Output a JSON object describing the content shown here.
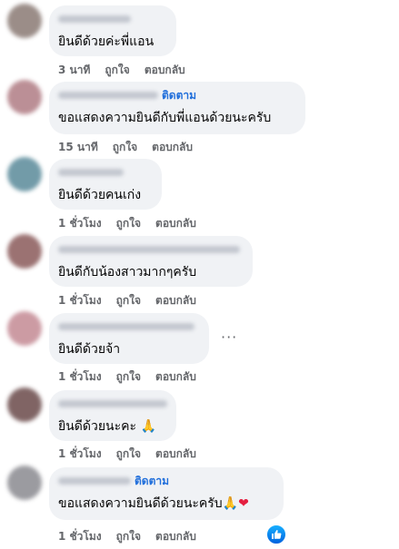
{
  "comments": [
    {
      "text": "ยินดีด้วยค่ะพี่แอน",
      "time": "3 นาที",
      "like": "ถูกใจ",
      "reply": "ตอบกลับ",
      "follow": ""
    },
    {
      "text": "ขอแสดงความยินดีกับพี่แอนด้วยนะครับ",
      "time": "15 นาที",
      "like": "ถูกใจ",
      "reply": "ตอบกลับ",
      "follow": "ติดตาม"
    },
    {
      "text": "ยินดีด้วยคนเก่ง",
      "time": "1 ชั่วโมง",
      "like": "ถูกใจ",
      "reply": "ตอบกลับ",
      "follow": ""
    },
    {
      "text": "ยินดีกับน้องสาวมากๆครับ",
      "time": "1 ชั่วโมง",
      "like": "ถูกใจ",
      "reply": "ตอบกลับ",
      "follow": ""
    },
    {
      "text": "ยินดีด้วยจ้า",
      "time": "1 ชั่วโมง",
      "like": "ถูกใจ",
      "reply": "ตอบกลับ",
      "follow": ""
    },
    {
      "text": "ยินดีด้วยนะคะ 🙏",
      "time": "1 ชั่วโมง",
      "like": "ถูกใจ",
      "reply": "ตอบกลับ",
      "follow": ""
    },
    {
      "text": "ขอแสดงความยินดีด้วยนะครับ🙏",
      "heart": "❤",
      "time": "1 ชั่วโมง",
      "like": "ถูกใจ",
      "reply": "ตอบกลับ",
      "follow": "ติดตาม"
    }
  ],
  "more_menu": "···",
  "icons": {
    "like_reaction": "thumbs-up-icon",
    "avatar_colors": [
      "#8a7a74",
      "#b07c84",
      "#5a8a9a",
      "#8a5a5a",
      "#c48a94",
      "#6a4a4a",
      "#8a8a90"
    ]
  }
}
